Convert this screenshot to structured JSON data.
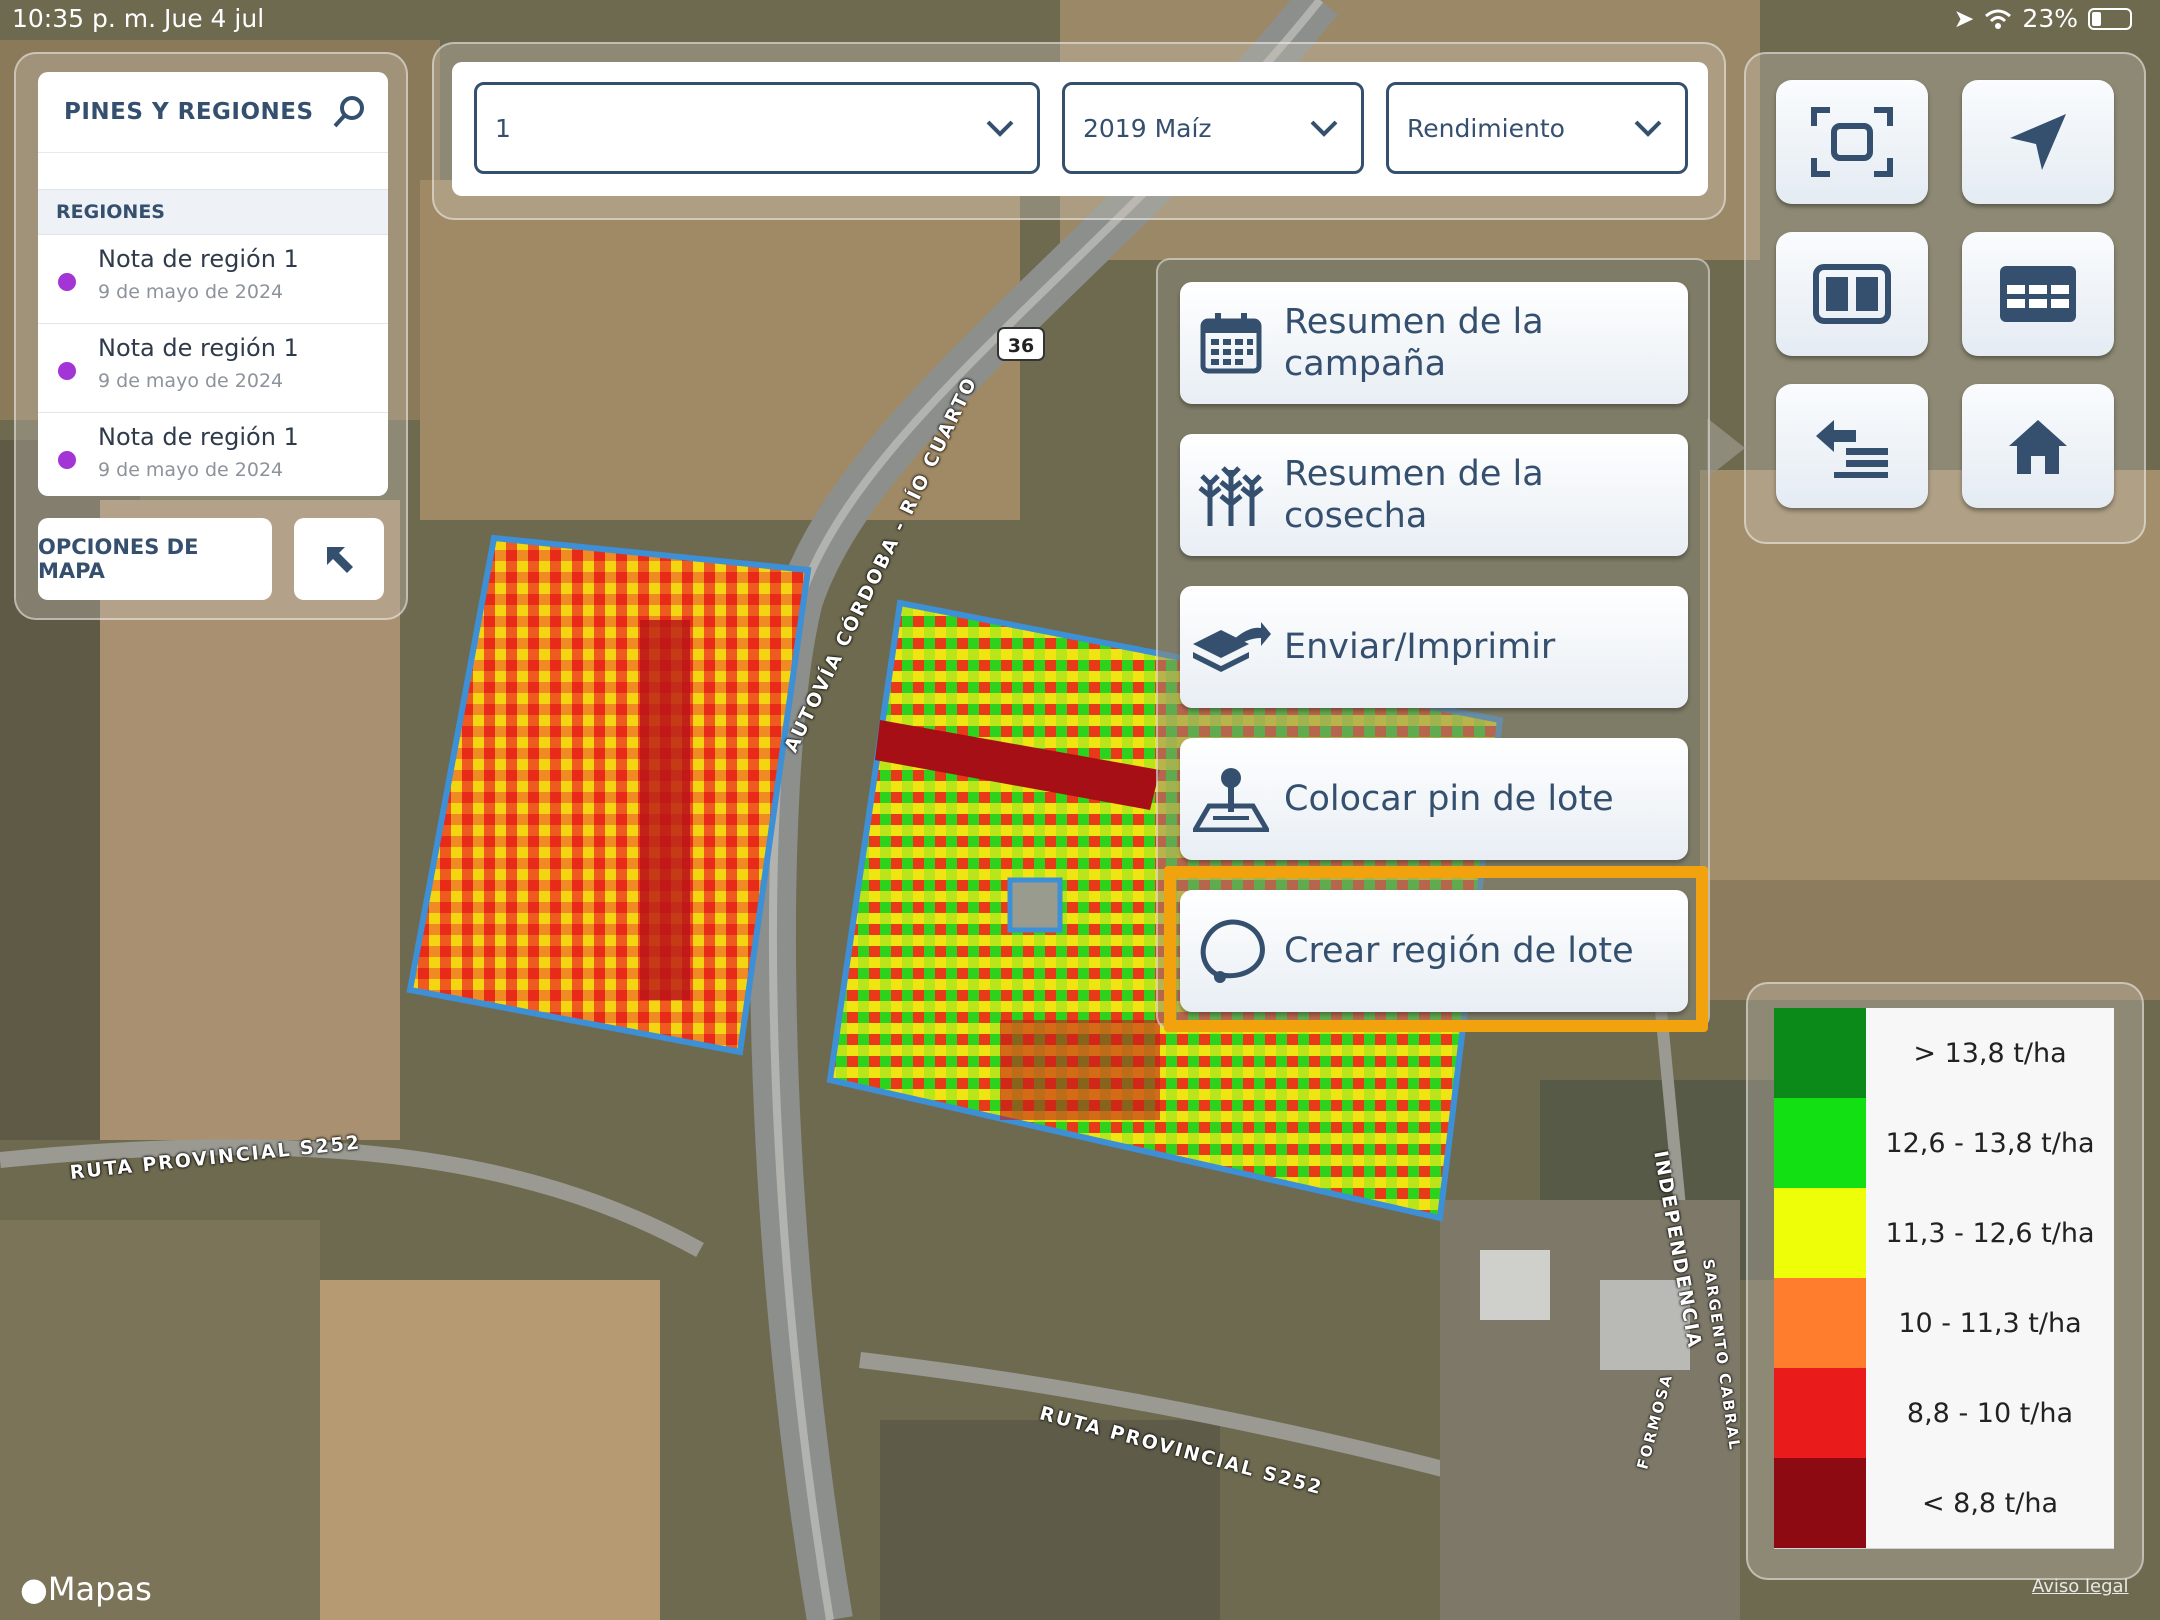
{
  "status_bar": {
    "time": "10:35 p. m.   Jue 4 jul",
    "battery": "23%"
  },
  "pins_panel": {
    "title": "PINES Y REGIONES",
    "section": "REGIONES",
    "regions": [
      {
        "name": "Nota de región 1",
        "date": "9 de mayo de 2024"
      },
      {
        "name": "Nota de región 1",
        "date": "9 de mayo de 2024"
      },
      {
        "name": "Nota de región 1",
        "date": "9 de mayo de 2024"
      }
    ],
    "map_options_label": "OPCIONES DE MAPA"
  },
  "filters": {
    "field": "1",
    "season": "2019 Maíz",
    "layer": "Rendimiento"
  },
  "menu": [
    {
      "label": "Resumen de la campaña",
      "icon": "calendar-icon"
    },
    {
      "label": "Resumen de la cosecha",
      "icon": "corn-icon"
    },
    {
      "label": "Enviar/Imprimir",
      "icon": "send-icon"
    },
    {
      "label": "Colocar pin de lote",
      "icon": "pin-icon"
    },
    {
      "label": "Crear región de lote",
      "icon": "lasso-icon"
    }
  ],
  "legend": [
    {
      "label": "> 13,8 t/ha",
      "color": "#0b8a1a"
    },
    {
      "label": "12,6 - 13,8 t/ha",
      "color": "#12e012"
    },
    {
      "label": "11,3 - 12,6 t/ha",
      "color": "#eefe08"
    },
    {
      "label": "10 - 11,3 t/ha",
      "color": "#ff7d2c"
    },
    {
      "label": "8,8 - 10 t/ha",
      "color": "#ea1b1b"
    },
    {
      "label": "< 8,8 t/ha",
      "color": "#8d0a12"
    }
  ],
  "map_labels": {
    "road_36": "36",
    "autovia": "AUTOVÍA CÓRDOBA - RÍO CUARTO",
    "ruta_s252_a": "RUTA PROVINCIAL S252",
    "ruta_s252_b": "RUTA PROVINCIAL S252",
    "independencia": "INDEPENDENCIA",
    "sargento": "SARGENTO CABRAL",
    "formosa": "FORMOSA"
  },
  "footer": {
    "brand": "Mapas",
    "legal": "Aviso legal"
  },
  "colors": {
    "accent": "#35506f",
    "highlight": "#f2a20c",
    "region_dot": "#a334d6"
  }
}
